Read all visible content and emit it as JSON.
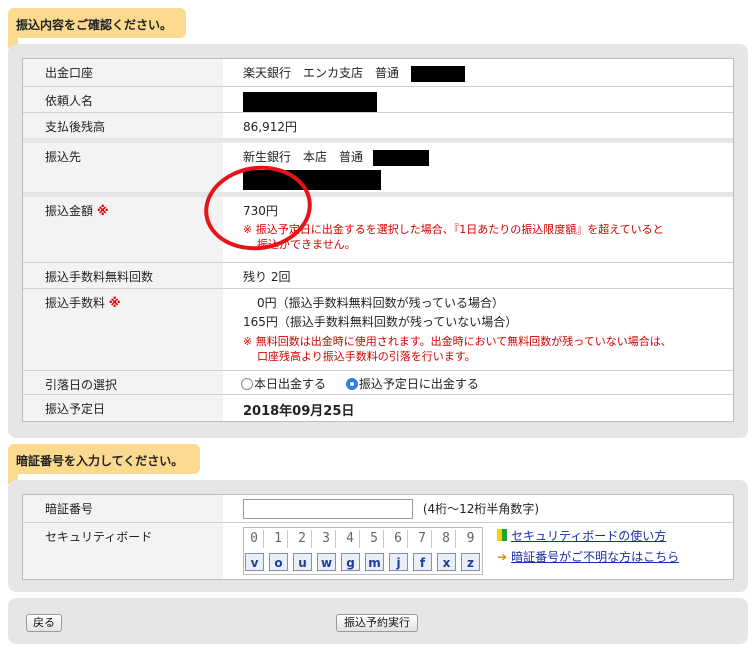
{
  "section1": {
    "title": "振込内容をご確認ください。"
  },
  "rows": {
    "source_account": {
      "label": "出金口座",
      "value": "楽天銀行　エンカ支店　普通"
    },
    "requester": {
      "label": "依頼人名"
    },
    "balance_after": {
      "label": "支払後残高",
      "value": "86,912円"
    },
    "payee": {
      "label": "振込先",
      "value": "新生銀行　本店　普通"
    },
    "amount": {
      "label": "振込金額",
      "required_mark": "※",
      "value": "730円",
      "note_line1": "※ 振込予定日に出金するを選択した場合、『1日あたりの振込限度額』を超えていると",
      "note_line2": "振込ができません。"
    },
    "free_count": {
      "label": "振込手数料無料回数",
      "value": "残り 2回"
    },
    "fee": {
      "label": "振込手数料",
      "required_mark": "※",
      "line1": "0円（振込手数料無料回数が残っている場合）",
      "line2": "165円（振込手数料無料回数が残っていない場合）",
      "note_line1": "※ 無料回数は出金時に使用されます。出金時において無料回数が残っていない場合は、",
      "note_line2": "口座残高より振込手数料の引落を行います。"
    },
    "debit_date": {
      "label": "引落日の選択",
      "option_today": "本日出金する",
      "option_scheduled": "振込予定日に出金する",
      "selected": "振込予定日に出金する"
    },
    "scheduled_date": {
      "label": "振込予定日",
      "value": "2018年09月25日"
    }
  },
  "section2": {
    "title": "暗証番号を入力してください。"
  },
  "pin": {
    "label": "暗証番号",
    "hint": "(4桁〜12桁半角数字)",
    "value": ""
  },
  "security_board": {
    "label": "セキュリティボード",
    "digits": [
      "0",
      "1",
      "2",
      "3",
      "4",
      "5",
      "6",
      "7",
      "8",
      "9"
    ],
    "letters": [
      "v",
      "o",
      "u",
      "w",
      "g",
      "m",
      "j",
      "f",
      "x",
      "z"
    ],
    "link_howto": "セキュリティボードの使い方",
    "link_forgot": "暗証番号がご不明な方はこちら"
  },
  "buttons": {
    "back": "戻る",
    "execute": "振込予約実行"
  },
  "colors": {
    "tab": "#fbd98e",
    "panel": "#e6e6e6",
    "required": "#d40000",
    "link": "#1a2da8",
    "annotation_circle": "#e8131a"
  }
}
